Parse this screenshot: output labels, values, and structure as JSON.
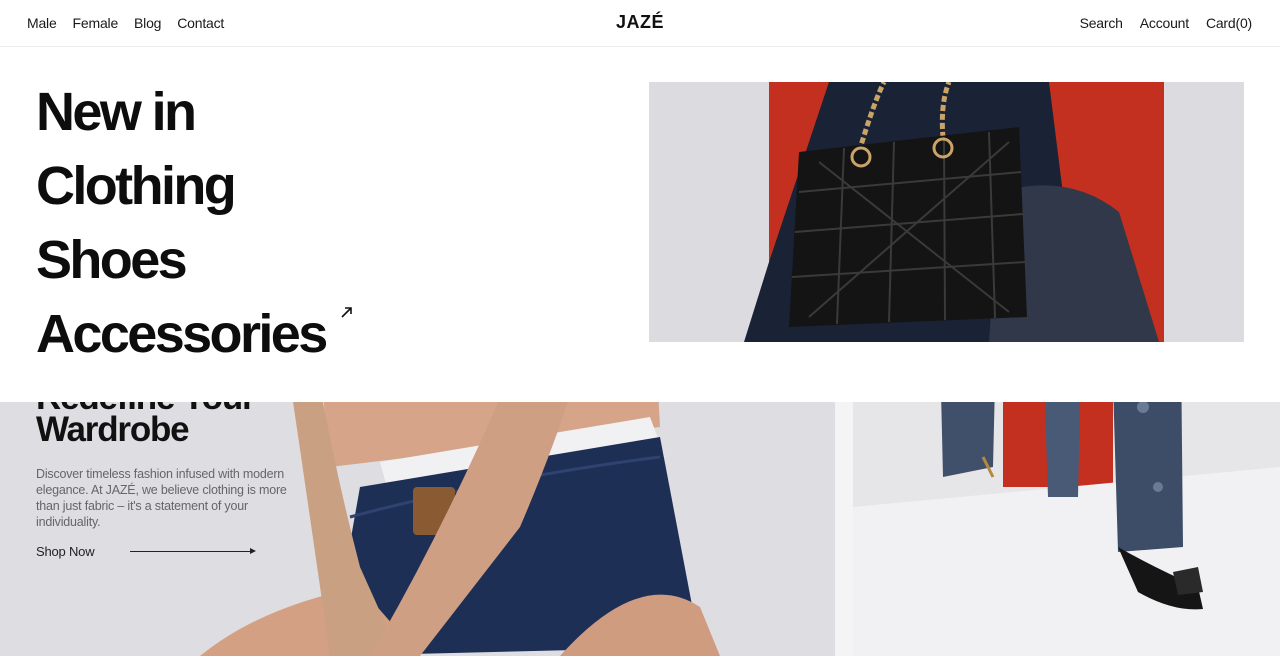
{
  "header": {
    "logo": "JAZÉ",
    "nav_left": [
      "Male",
      "Female",
      "Blog",
      "Contact"
    ],
    "nav_right": [
      "Search",
      "Account",
      "Card(0)"
    ]
  },
  "menu": {
    "items": [
      "New in",
      "Clothing",
      "Shoes",
      "Accessories"
    ],
    "image_alt": "black-quilted-handbag-photo"
  },
  "hero": {
    "title": "Redefine Your\nWardrobe",
    "description": "Discover timeless fashion infused with modern elegance. At JAZÉ, we believe clothing is more than just fabric – it's a statement of your individuality.",
    "cta": "Shop Now"
  },
  "colors": {
    "accent_red": "#c3301f",
    "denim": "#1e2f55",
    "text_dark": "#0d0d0d"
  }
}
